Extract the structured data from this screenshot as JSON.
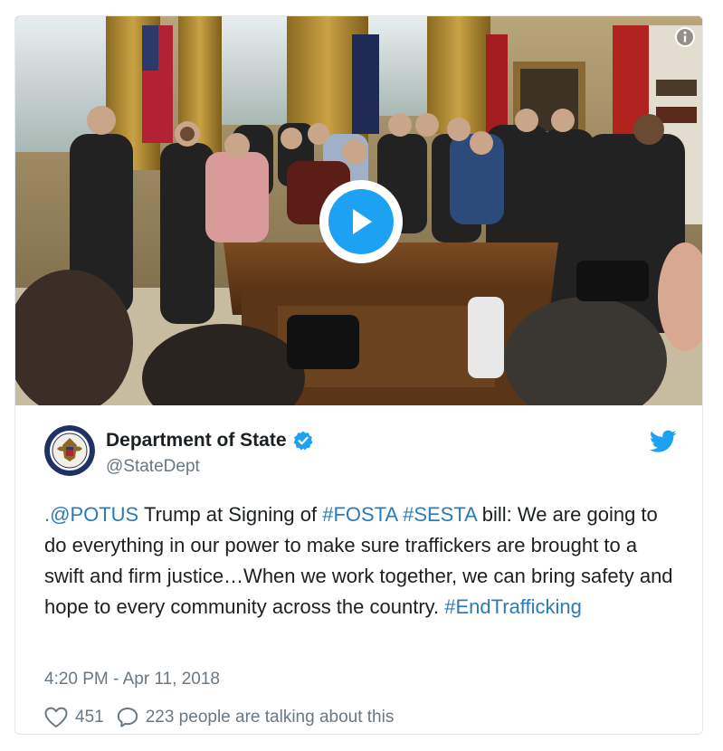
{
  "media": {
    "type": "video",
    "play_icon": "play-icon",
    "info_icon": "info-icon"
  },
  "author": {
    "name": "Department of State",
    "handle": "@StateDept",
    "verified_icon": "verified-badge-icon",
    "avatar_icon": "state-department-seal"
  },
  "platform_icon": "twitter-bird-icon",
  "tweet": {
    "segments": [
      {
        "text": ".@POTUS",
        "link": true
      },
      {
        "text": " Trump at Signing of ",
        "link": false
      },
      {
        "text": "#FOSTA",
        "link": true
      },
      {
        "text": " ",
        "link": false
      },
      {
        "text": "#SESTA",
        "link": true
      },
      {
        "text": " bill: We are going to do everything in our power to make sure traffickers are brought to a swift and firm justice…When we work together, we can bring safety and hope to every community across the country. ",
        "link": false
      },
      {
        "text": "#EndTrafficking",
        "link": true
      }
    ],
    "timestamp": "4:20 PM - Apr 11, 2018"
  },
  "actions": {
    "like_count": "451",
    "like_icon": "heart-icon",
    "reply_text": "223 people are talking about this",
    "reply_icon": "speech-bubble-icon"
  },
  "colors": {
    "accent": "#1da1f2",
    "link": "#2b7bb9",
    "muted": "#697882",
    "text": "#1c2022",
    "border": "#e1e8ed"
  }
}
